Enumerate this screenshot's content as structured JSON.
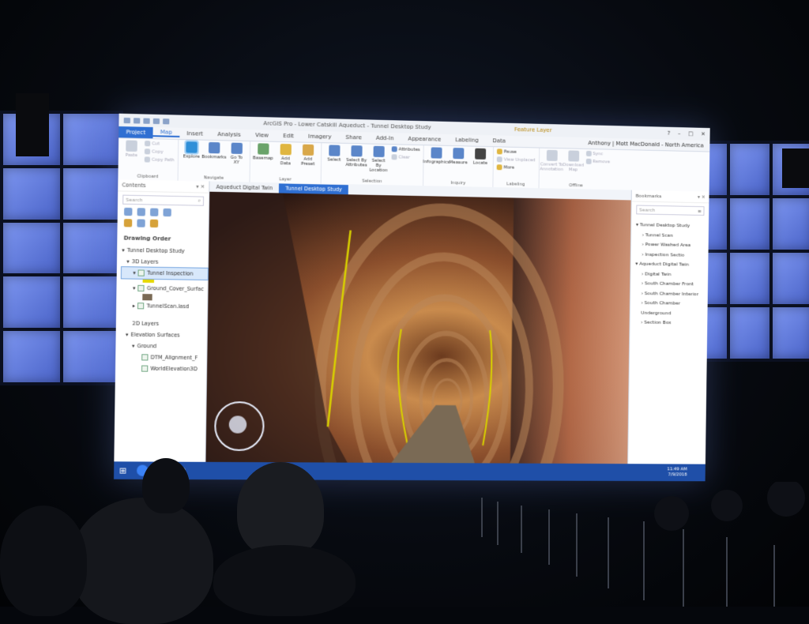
{
  "window": {
    "title": "ArcGIS Pro - Lower Catskill Aqueduct - Tunnel Desktop Study",
    "context_tab": "Feature Layer",
    "controls": [
      "?",
      "–",
      "□",
      "✕"
    ]
  },
  "ribbon_tabs": [
    "Project",
    "Map",
    "Insert",
    "Analysis",
    "View",
    "Edit",
    "Imagery",
    "Share",
    "Add-In",
    "Appearance",
    "Labeling",
    "Data"
  ],
  "user": "Anthony | Mott MacDonald - North America",
  "ribbon_groups": {
    "clipboard": {
      "name": "Clipboard",
      "items": [
        "Cut",
        "Copy",
        "Paste",
        "Copy Path"
      ]
    },
    "navigate": {
      "name": "Navigate",
      "items": [
        "Explore",
        "Bookmarks",
        "Go To XY"
      ]
    },
    "layer": {
      "name": "Layer",
      "items": [
        "Basemap",
        "Add Data",
        "Add Preset"
      ]
    },
    "selection": {
      "name": "Selection",
      "items": [
        "Select",
        "Select By Attributes",
        "Select By Location",
        "Attributes",
        "Clear"
      ]
    },
    "inquiry": {
      "name": "Inquiry",
      "items": [
        "Infographics",
        "Measure",
        "Locate"
      ]
    },
    "labeling": {
      "name": "Labeling",
      "items": [
        "Pause",
        "View Unplaced",
        "More"
      ]
    },
    "offline": {
      "name": "Offline",
      "items": [
        "Convert To Annotation",
        "Download Map",
        "Sync",
        "Remove"
      ]
    }
  },
  "contents": {
    "title": "Contents",
    "search_placeholder": "Search",
    "drawing_order": "Drawing Order",
    "tree": {
      "root": "Tunnel Desktop Study",
      "group_3d": "3D Layers",
      "tunnel_inspection": "Tunnel Inspection",
      "ground_cover": "Ground_Cover_Surfac",
      "tunnel_scan": "TunnelScan.lasd",
      "group_2d": "2D Layers",
      "elevation_surfaces": "Elevation Surfaces",
      "ground": "Ground",
      "dtm": "DTM_Alignment_F",
      "world_elevation": "WorldElevation3D"
    },
    "colors": {
      "tunnel_inspection": "#e6d800",
      "ground_cover": "#7a6a55"
    }
  },
  "view_tabs": [
    "Aqueduct Digital Twin",
    "Tunnel Desktop Study"
  ],
  "bookmarks": {
    "title": "Bookmarks",
    "search_placeholder": "Search",
    "items": [
      {
        "label": "Tunnel Desktop Study",
        "level": 1
      },
      {
        "label": "Tunnel Scan",
        "level": 2
      },
      {
        "label": "Power Washed Area",
        "level": 2
      },
      {
        "label": "Inspection Sectio",
        "level": 2
      },
      {
        "label": "Aqueduct Digital Twin",
        "level": 1
      },
      {
        "label": "Digital Twin",
        "level": 2
      },
      {
        "label": "South Chamber Front",
        "level": 2
      },
      {
        "label": "South Chamber Interior",
        "level": 2
      },
      {
        "label": "South Chamber Underground",
        "level": 2
      },
      {
        "label": "Section Box",
        "level": 2
      }
    ]
  },
  "taskbar": {
    "time": "11:49 AM",
    "date": "7/9/2018"
  },
  "theme": {
    "accent": "#2f6fd2",
    "taskbar": "#1f4fa8",
    "wall_tile": "#6f89e8"
  }
}
